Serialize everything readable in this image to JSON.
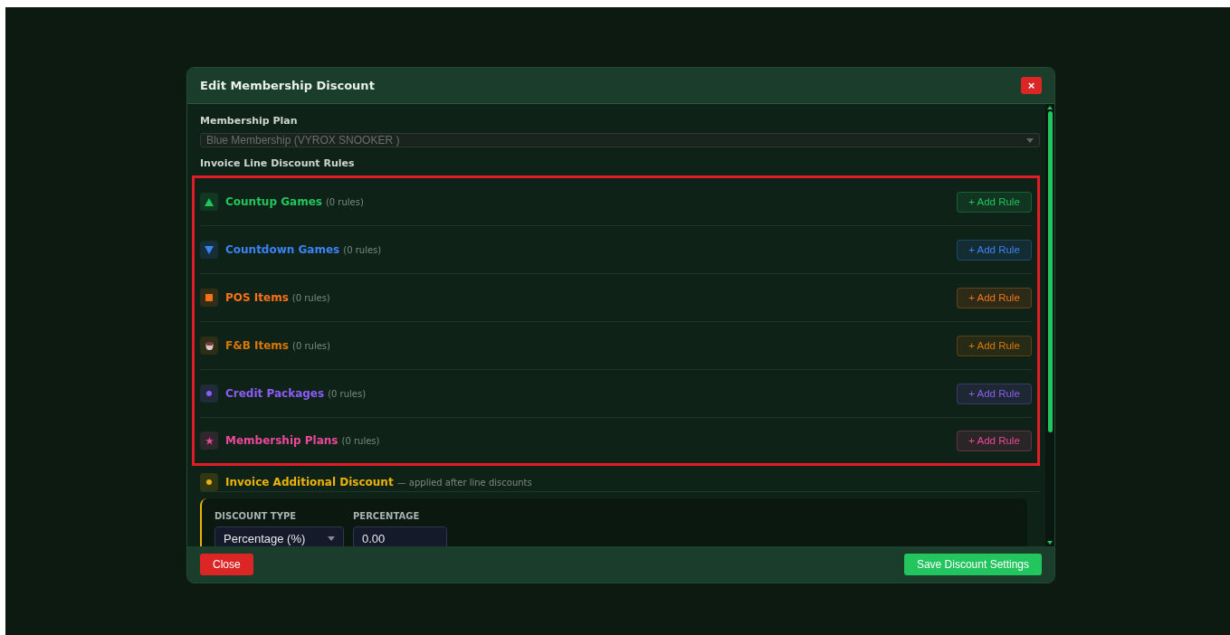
{
  "dialog": {
    "title": "Edit Membership Discount",
    "close_icon": "×"
  },
  "membership_plan": {
    "label": "Membership Plan",
    "value": "Blue Membership (VYROX SNOOKER )",
    "disabled": true
  },
  "rules_section": {
    "title": "Invoice Line Discount Rules",
    "highlighted": true,
    "categories": [
      {
        "kind": "up",
        "name": "Countup Games",
        "count": "(0 rules)",
        "color": "#22c55e",
        "button": "+ Add Rule"
      },
      {
        "kind": "down",
        "name": "Countdown Games",
        "count": "(0 rules)",
        "color": "#3b82f6",
        "button": "+ Add Rule"
      },
      {
        "kind": "square",
        "name": "POS Items",
        "count": "(0 rules)",
        "color": "#f97316",
        "button": "+ Add Rule"
      },
      {
        "kind": "cup",
        "name": "F&B Items",
        "count": "(0 rules)",
        "color": "#d97706",
        "button": "+ Add Rule"
      },
      {
        "kind": "dot",
        "name": "Credit Packages",
        "count": "(0 rules)",
        "color": "#8b5cf6",
        "button": "+ Add Rule"
      },
      {
        "kind": "star",
        "name": "Membership Plans",
        "count": "(0 rules)",
        "color": "#ec4899",
        "button": "+ Add Rule"
      }
    ]
  },
  "additional_discount": {
    "title": "Invoice Additional Discount",
    "note": "— applied after line discounts",
    "color": "#eab308",
    "fields": [
      {
        "label": "DISCOUNT TYPE",
        "kind": "select",
        "value": "Percentage (%)"
      },
      {
        "label": "PERCENTAGE",
        "kind": "input",
        "value": "0.00"
      }
    ]
  },
  "footer": {
    "close": "Close",
    "save": "Save Discount Settings"
  }
}
